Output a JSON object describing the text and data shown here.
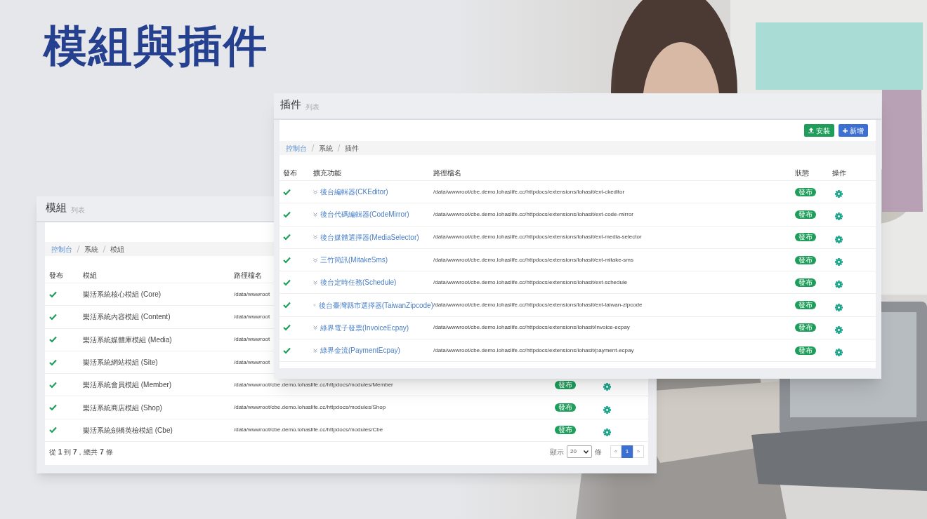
{
  "title": "模組與插件",
  "modules_window": {
    "title": "模組",
    "subtitle": "列表",
    "breadcrumb": [
      {
        "label": "控制台",
        "link": true
      },
      {
        "label": "系統",
        "link": false
      },
      {
        "label": "模組",
        "link": false
      }
    ],
    "columns": [
      "發布",
      "模組",
      "路徑檔名"
    ],
    "rows": [
      {
        "published": true,
        "name": "樂活系統核心模組 (Core)",
        "path": "/data/wwwroot"
      },
      {
        "published": true,
        "name": "樂活系統內容模組 (Content)",
        "path": "/data/wwwroot"
      },
      {
        "published": true,
        "name": "樂活系統媒體庫模組 (Media)",
        "path": "/data/wwwroot"
      },
      {
        "published": true,
        "name": "樂活系統網站模組 (Site)",
        "path": "/data/wwwroot"
      },
      {
        "published": true,
        "name": "樂活系統會員模組 (Member)",
        "path": "/data/wwwroot/cbe.demo.lohaslife.cc/httpdocs/modules/Member",
        "status": "發布"
      },
      {
        "published": true,
        "name": "樂活系統商店模組 (Shop)",
        "path": "/data/wwwroot/cbe.demo.lohaslife.cc/httpdocs/modules/Shop",
        "status": "發布"
      },
      {
        "published": true,
        "name": "樂活系統劍橋英檢模組 (Cbe)",
        "path": "/data/wwwroot/cbe.demo.lohaslife.cc/httpdocs/modules/Cbe",
        "status": "發布"
      }
    ],
    "summary": "從 **1** 到 **7**，總共 **7** 條",
    "page_size_label": "顯示",
    "page_size": "20",
    "page_size_unit": "條",
    "pages": [
      {
        "label": "«",
        "selected": false
      },
      {
        "label": "1",
        "selected": true
      },
      {
        "label": "»",
        "selected": false
      }
    ]
  },
  "plugins_window": {
    "title": "插件",
    "subtitle": "列表",
    "buttons": [
      {
        "label": "安裝",
        "kind": "install"
      },
      {
        "label": "新增",
        "kind": "add"
      }
    ],
    "breadcrumb": [
      {
        "label": "控制台",
        "link": true
      },
      {
        "label": "系統",
        "link": false
      },
      {
        "label": "插件",
        "link": false
      }
    ],
    "columns": [
      "發布",
      "擴充功能",
      "路徑檔名",
      "狀態",
      "操作"
    ],
    "rows": [
      {
        "published": true,
        "name": "後台編輯器(CKEditor)",
        "path": "/data/wwwroot/cbe.demo.lohaslife.cc/httpdocs/extensions/lohasit/ext-ckeditor",
        "status": "發布"
      },
      {
        "published": true,
        "name": "後台代碼編輯器(CodeMirror)",
        "path": "/data/wwwroot/cbe.demo.lohaslife.cc/httpdocs/extensions/lohasit/ext-code-mirror",
        "status": "發布"
      },
      {
        "published": true,
        "name": "後台媒體選擇器(MediaSelector)",
        "path": "/data/wwwroot/cbe.demo.lohaslife.cc/httpdocs/extensions/lohasit/ext-media-selector",
        "status": "發布"
      },
      {
        "published": true,
        "name": "三竹簡訊(MitakeSms)",
        "path": "/data/wwwroot/cbe.demo.lohaslife.cc/httpdocs/extensions/lohasit/ext-mitake-sms",
        "status": "發布"
      },
      {
        "published": true,
        "name": "後台定時任務(Schedule)",
        "path": "/data/wwwroot/cbe.demo.lohaslife.cc/httpdocs/extensions/lohasit/ext-schedule",
        "status": "發布"
      },
      {
        "published": true,
        "name": "後台臺灣縣市選擇器(TaiwanZipcode)",
        "path": "/data/wwwroot/cbe.demo.lohaslife.cc/httpdocs/extensions/lohasit/ext-taiwan-zipcode",
        "status": "發布"
      },
      {
        "published": true,
        "name": "綠界電子發票(InvoiceEcpay)",
        "path": "/data/wwwroot/cbe.demo.lohaslife.cc/httpdocs/extensions/lohasit/invoice-ecpay",
        "status": "發布"
      },
      {
        "published": true,
        "name": "綠界金流(PaymentEcpay)",
        "path": "/data/wwwroot/cbe.demo.lohaslife.cc/httpdocs/extensions/lohasit/payment-ecpay",
        "status": "發布"
      }
    ]
  }
}
